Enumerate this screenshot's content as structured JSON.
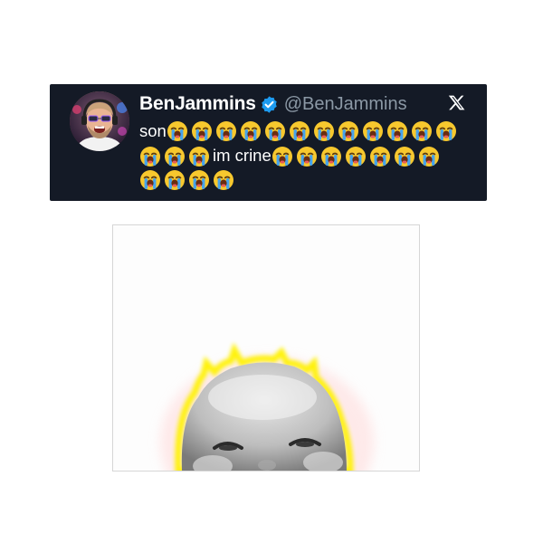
{
  "tweet": {
    "display_name": "BenJammins",
    "handle": "@BenJammins",
    "verified": true,
    "lines": [
      {
        "text_before": "son",
        "emoji_count": 12,
        "text_after": ""
      },
      {
        "text_before": "",
        "emoji_count_before": 3,
        "text_middle": "im crine",
        "emoji_count_after": 7
      },
      {
        "emoji_count": 4
      }
    ],
    "emoji": "loudly-crying-face",
    "colors": {
      "card_background": "#141a26",
      "name": "#ffffff",
      "handle": "#8b98a5",
      "verified": "#1d9bf0"
    },
    "icons": {
      "verified": "verified-badge-icon",
      "platform": "x-logo-icon"
    }
  },
  "media": {
    "description_icon": "baby-face-image",
    "colors": {
      "glow": "#ffe600",
      "background": "#fdfdfd"
    }
  }
}
